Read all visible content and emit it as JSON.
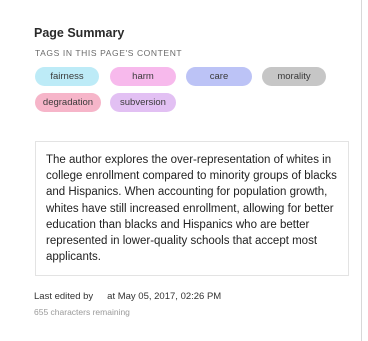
{
  "panel": {
    "title": "Page Summary",
    "tags_heading": "TAGS IN THIS PAGE'S CONTENT",
    "tags": [
      {
        "label": "fairness",
        "color": "#bdebf7"
      },
      {
        "label": "harm",
        "color": "#f7b9ec"
      },
      {
        "label": "care",
        "color": "#bcc3f6"
      },
      {
        "label": "morality",
        "color": "#c6c6c6"
      },
      {
        "label": "degradation",
        "color": "#f6b5c9"
      },
      {
        "label": "subversion",
        "color": "#e2c0f3"
      }
    ],
    "summary": "The author explores the over-representation of whites in college enrollment compared to minority groups of blacks and Hispanics. When accounting for population growth, whites have still increased enrollment, allowing for better education than blacks and Hispanics who are better represented in lower-quality schools that accept most applicants.",
    "edited_label": "Last edited by",
    "edited_time": "at May 05, 2017, 02:26 PM",
    "characters_remaining": "655 characters remaining"
  }
}
